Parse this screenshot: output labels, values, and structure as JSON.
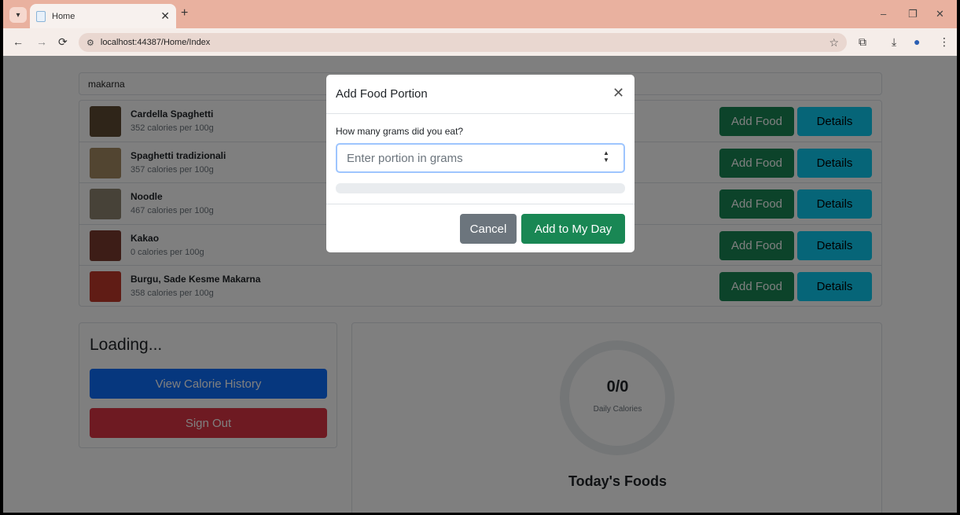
{
  "browser": {
    "tab_title": "Home",
    "url": "localhost:44387/Home/Index",
    "icons": {
      "tab_menu": "▾",
      "tab_close": "✕",
      "new_tab": "+",
      "minimize": "–",
      "restore": "❐",
      "close": "✕",
      "back": "←",
      "forward": "→",
      "reload": "⟳",
      "site_info": "⚙",
      "star": "☆",
      "extensions": "⧉",
      "download": "⤓",
      "profile": "●",
      "menu": "⋮"
    }
  },
  "search": {
    "value": "makarna"
  },
  "foods": [
    {
      "name": "Cardella Spaghetti",
      "calories": "352 calories per 100g",
      "thumb_color": "#5e4a32"
    },
    {
      "name": "Spaghetti tradizionali",
      "calories": "357 calories per 100g",
      "thumb_color": "#a48b63"
    },
    {
      "name": "Noodle",
      "calories": "467 calories per 100g",
      "thumb_color": "#8e8470"
    },
    {
      "name": "Kakao",
      "calories": "0 calories per 100g",
      "thumb_color": "#7a3b2e"
    },
    {
      "name": "Burgu, Sade Kesme Makarna",
      "calories": "358 calories per 100g",
      "thumb_color": "#c0392b"
    }
  ],
  "row_buttons": {
    "add_label": "Add Food",
    "details_label": "Details"
  },
  "profile_card": {
    "heading": "Loading...",
    "history_label": "View Calorie History",
    "signout_label": "Sign Out"
  },
  "daily": {
    "value": "0/0",
    "label": "Daily Calories",
    "today_heading": "Today's Foods",
    "progress_fraction": 0
  },
  "modal": {
    "title": "Add Food Portion",
    "close_icon": "✕",
    "prompt": "How many grams did you eat?",
    "input_placeholder": "Enter portion in grams",
    "spin_icon": "▲▼",
    "progress_percent": 0,
    "cancel_label": "Cancel",
    "confirm_label": "Add to My Day"
  },
  "colors": {
    "primary": "#0d6efd",
    "success": "#198754",
    "info": "#0dcaf0",
    "danger": "#dc3545",
    "secondary": "#6c757d",
    "tabbar": "#e9b19f"
  }
}
